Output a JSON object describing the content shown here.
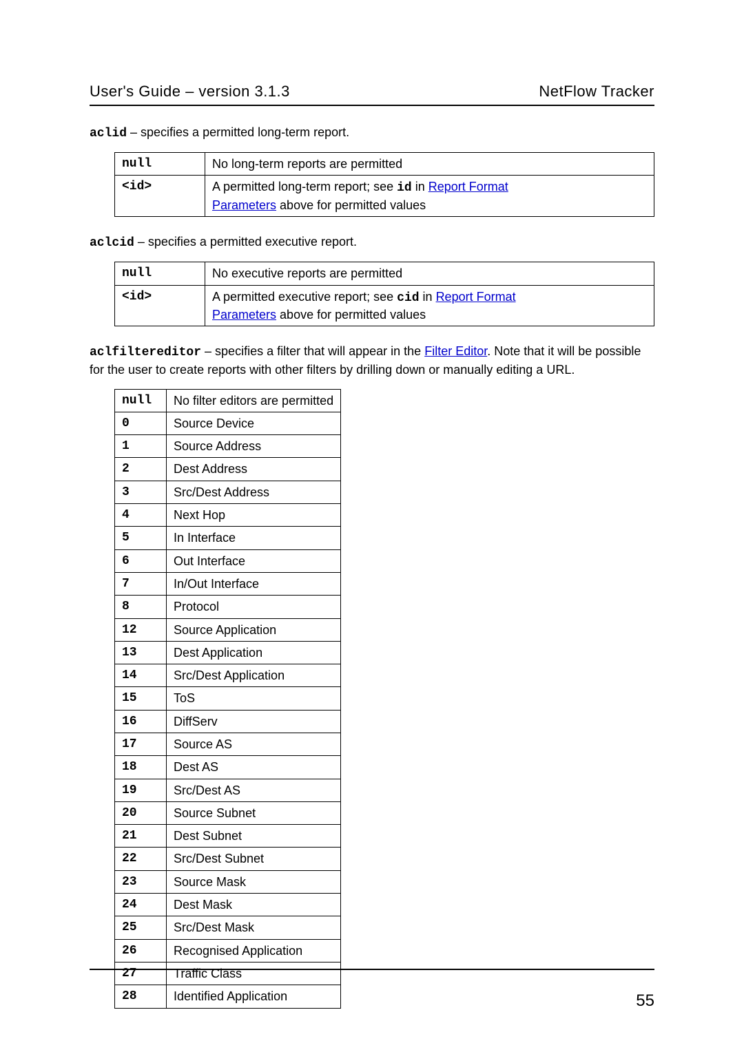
{
  "header": {
    "left": "User's Guide – version 3.1.3",
    "right": "NetFlow Tracker"
  },
  "aclid": {
    "name": "aclid",
    "desc_tail": " – specifies a permitted long-term report.",
    "rows": [
      {
        "key": "null",
        "plain": "No long-term reports are permitted"
      },
      {
        "key": "<id>",
        "pre": "A permitted long-term report; see ",
        "mono": "id",
        "mid": " in ",
        "link1": "Report Format",
        "br": true,
        "link2": "Parameters",
        "post": " above for permitted values"
      }
    ]
  },
  "aclcid": {
    "name": "aclcid",
    "desc_tail": " – specifies a permitted executive report.",
    "rows": [
      {
        "key": "null",
        "plain": "No executive reports are permitted"
      },
      {
        "key": "<id>",
        "pre": "A permitted executive report; see ",
        "mono": "cid",
        "mid": " in ",
        "link1": "Report Format",
        "br": true,
        "link2": "Parameters",
        "post": " above for permitted values"
      }
    ]
  },
  "aclfiltereditor": {
    "name": "aclfiltereditor",
    "desc_pre": " – specifies a filter that will appear in the ",
    "link": "Filter Editor",
    "desc_post": ". Note that it will be possible for the user to create reports with other filters by drilling down or manually editing a URL.",
    "rows": [
      {
        "key": "null",
        "val": "No filter editors are permitted"
      },
      {
        "key": "0",
        "val": "Source Device"
      },
      {
        "key": "1",
        "val": "Source Address"
      },
      {
        "key": "2",
        "val": "Dest Address"
      },
      {
        "key": "3",
        "val": "Src/Dest Address"
      },
      {
        "key": "4",
        "val": "Next Hop"
      },
      {
        "key": "5",
        "val": "In Interface"
      },
      {
        "key": "6",
        "val": "Out Interface"
      },
      {
        "key": "7",
        "val": "In/Out Interface"
      },
      {
        "key": "8",
        "val": "Protocol"
      },
      {
        "key": "12",
        "val": "Source Application"
      },
      {
        "key": "13",
        "val": "Dest Application"
      },
      {
        "key": "14",
        "val": "Src/Dest Application"
      },
      {
        "key": "15",
        "val": "ToS"
      },
      {
        "key": "16",
        "val": "DiffServ"
      },
      {
        "key": "17",
        "val": "Source AS"
      },
      {
        "key": "18",
        "val": "Dest AS"
      },
      {
        "key": "19",
        "val": "Src/Dest AS"
      },
      {
        "key": "20",
        "val": "Source Subnet"
      },
      {
        "key": "21",
        "val": "Dest Subnet"
      },
      {
        "key": "22",
        "val": "Src/Dest Subnet"
      },
      {
        "key": "23",
        "val": "Source Mask"
      },
      {
        "key": "24",
        "val": "Dest Mask"
      },
      {
        "key": "25",
        "val": "Src/Dest Mask"
      },
      {
        "key": "26",
        "val": "Recognised Application"
      },
      {
        "key": "27",
        "val": "Traffic Class"
      },
      {
        "key": "28",
        "val": "Identified Application"
      }
    ]
  },
  "page_number": "55"
}
